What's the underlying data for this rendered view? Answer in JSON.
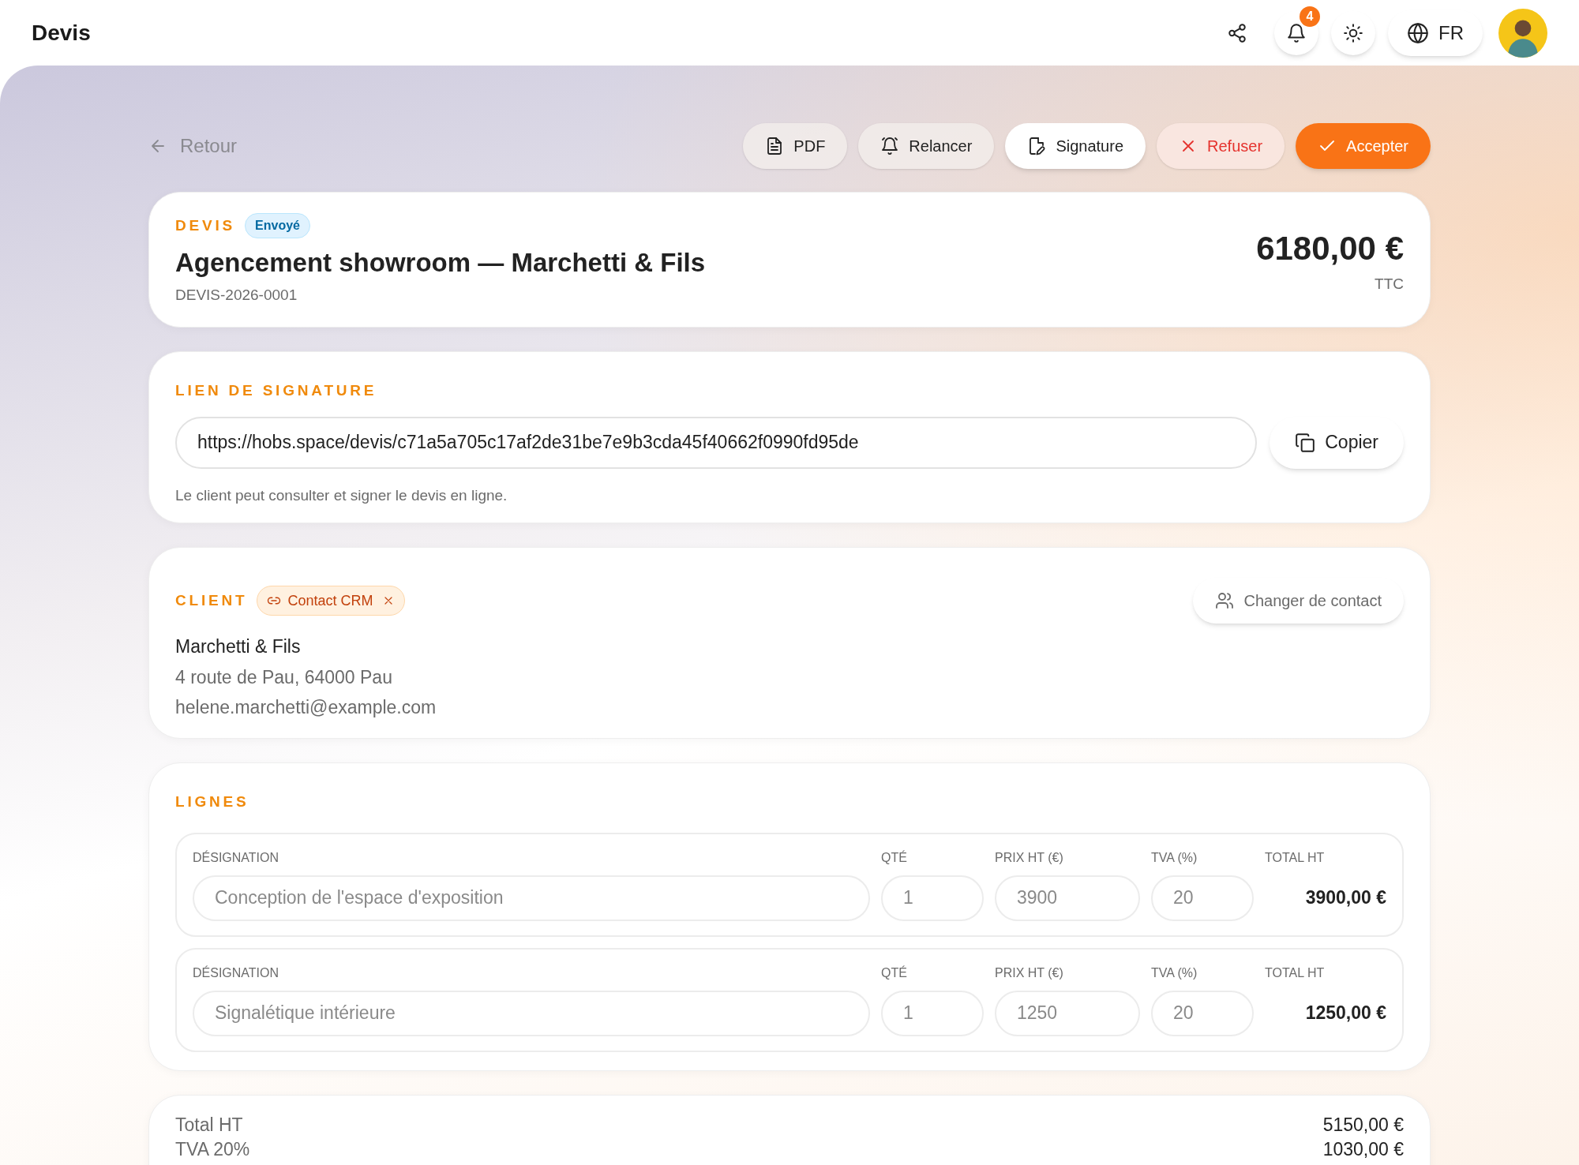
{
  "app_bar": {
    "title": "Devis",
    "notifications": {
      "count": "4"
    },
    "language": "FR"
  },
  "back": "Retour",
  "actions": [
    {
      "label": "PDF",
      "kind": "document"
    },
    {
      "label": "Relancer",
      "kind": "remind"
    },
    {
      "label": "Signature",
      "kind": "sign"
    },
    {
      "label": "Refuser",
      "kind": "reject"
    },
    {
      "label": "Accepter",
      "kind": "accept"
    }
  ],
  "quote": {
    "eyebrow": "DEVIS",
    "status": "Envoyé",
    "title": "Agencement showroom — Marchetti & Fils",
    "number": "DEVIS-2026-0001",
    "amount": "6180,00 €",
    "amount_note": "TTC"
  },
  "signature_link": {
    "heading": "LIEN DE SIGNATURE",
    "url": "https://hobs.space/devis/c71a5a705c17af2de31be7e9b3cda45f40662f0990fd95de",
    "copy_button": "Copier",
    "hint": "Le client peut consulter et signer le devis en ligne."
  },
  "client": {
    "heading": "CLIENT",
    "crm_tag": "Contact CRM",
    "change_button": "Changer de contact",
    "name": "Marchetti & Fils",
    "address": "4 route de Pau, 64000 Pau",
    "email": "helene.marchetti@example.com"
  },
  "lines": {
    "heading": "LIGNES",
    "rows": [
      {
        "designation_label": "DÉSIGNATION",
        "designation": "Conception de l'espace d'exposition",
        "qty_label": "QTÉ",
        "qty": "1",
        "price_label": "PRIX HT (€)",
        "price": "3900",
        "vat_label": "TVA (%)",
        "vat": "20",
        "total_label": "TOTAL HT",
        "total": "3900,00 €"
      },
      {
        "designation_label": "DÉSIGNATION",
        "designation": "Signalétique intérieure",
        "qty_label": "QTÉ",
        "qty": "1",
        "price_label": "PRIX HT (€)",
        "price": "1250",
        "vat_label": "TVA (%)",
        "vat": "20",
        "total_label": "TOTAL HT",
        "total": "1250,00 €"
      }
    ]
  },
  "totals": [
    {
      "label": "Total HT",
      "value": "5150,00 €"
    },
    {
      "label": "TVA 20%",
      "value": "1030,00 €"
    }
  ]
}
